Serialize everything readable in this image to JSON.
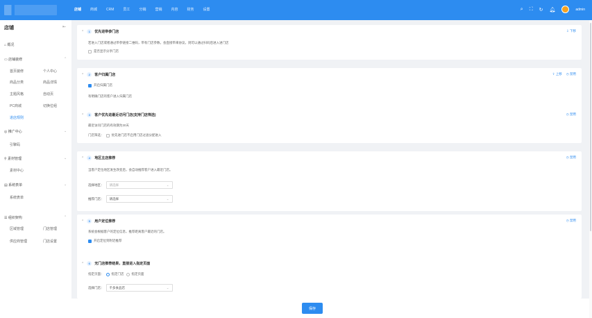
{
  "topbar": {
    "nav": [
      "店铺",
      "商城",
      "CRM",
      "员工",
      "分销",
      "营销",
      "内容",
      "财务",
      "设置"
    ],
    "user": "admin"
  },
  "sidebar": {
    "title": "店铺",
    "collapse_icon": "⇤",
    "overview": "概况",
    "groups": [
      {
        "label": "店铺装修",
        "items": [
          "首页装修",
          "个人中心",
          "商品分类",
          "商品详情",
          "主题风格",
          "自动页",
          "PC商城",
          "切换位组",
          "进店规则"
        ]
      },
      {
        "label": "推广中心",
        "items": [
          "引擎码"
        ]
      },
      {
        "label": "素材管理",
        "items": [
          "素材中心"
        ]
      },
      {
        "label": "系统表单",
        "items": [
          "系统表单"
        ]
      },
      {
        "label": "组织架构",
        "items": [
          "区域管理",
          "门店管理",
          "供应商管理",
          "门店设置"
        ]
      }
    ]
  },
  "cards": [
    {
      "num": "1",
      "title": "优先进带参门店",
      "actions": [
        "下移"
      ],
      "desc": "若进入门店或者通过带参链接二维码，带有门店参数，会直接带来协议，则可以通过扫码后进入进门店",
      "checkbox": {
        "label": "是否显示分享门店",
        "checked": false
      }
    },
    {
      "num": "2",
      "title": "客户归属门店",
      "actions": [
        "上移",
        "禁用"
      ],
      "checkbox": {
        "label": "开启归属门店",
        "checked": true
      },
      "desc": "有明确门店的客户进入归属门店"
    },
    {
      "num": "3",
      "title": "客户优先进最近访问门店(支持门店筛选)",
      "actions": [
        "禁用"
      ],
      "desc": "最近访问门店的有效期为30天",
      "radio_label": "门店筛选：",
      "radio_option": "优先进门店不启用门店过滤分配进入"
    },
    {
      "num": "4",
      "title": "地区主店推荐",
      "actions": [
        "禁用"
      ],
      "desc": "当客户定位地区发生改变后，会自动推荐客户进入最近门店。",
      "field1_label": "选择地区：",
      "field1_placeholder": "请选择",
      "field2_label": "推荐门店：",
      "field2_value": "请选择"
    },
    {
      "num": "5",
      "title": "用户定位推荐",
      "actions": [
        "禁用"
      ],
      "desc": "系统会根据客户的定位信息，推荐距离客户最近的门店。",
      "checkbox": {
        "label": "开启定位到附近推荐",
        "checked": true
      }
    },
    {
      "num": "6",
      "title": "无门店推荐结果，直接进入指定页面",
      "actions": [],
      "radio_label": "指定页面：",
      "radio_opt1": "指定门店",
      "radio_opt2": "指定页面",
      "field_label": "选择门店：",
      "field_value": "千多食品店"
    }
  ],
  "footer": {
    "save": "保存"
  }
}
